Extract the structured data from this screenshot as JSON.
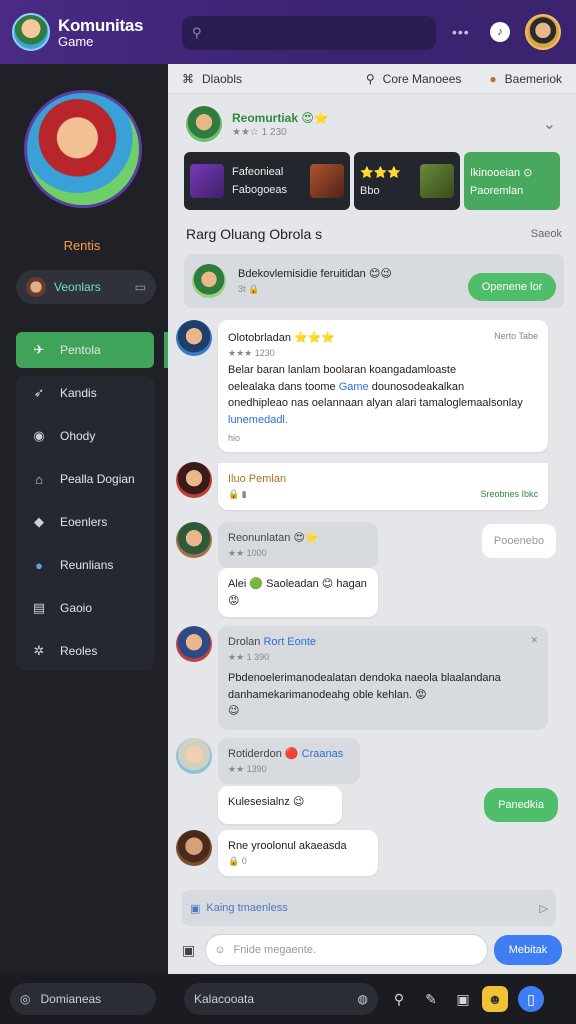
{
  "app": {
    "title": "Komunitas",
    "subtitle": "Game"
  },
  "topbar": {
    "search_placeholder": "",
    "dots": "•••",
    "bell_label": ""
  },
  "sidebar": {
    "hero_name": "Rentis",
    "profile_label": "Veonlars",
    "nav": [
      {
        "icon": "✈",
        "label": "Pentola",
        "active": true
      },
      {
        "icon": "➶",
        "label": "Kandis"
      },
      {
        "icon": "◉",
        "label": "Ohody"
      },
      {
        "icon": "⌂",
        "label": "Pealla Dogian"
      },
      {
        "icon": "◆",
        "label": "Eoenlers"
      },
      {
        "icon": "●",
        "label": "Reunlians"
      },
      {
        "icon": "▤",
        "label": "Gaoio"
      },
      {
        "icon": "✲",
        "label": "Reoles"
      }
    ]
  },
  "main": {
    "tabs": {
      "left_label": "Dlaobls",
      "right1_label": "Core Manoees",
      "right2_label": "Baemeriok"
    },
    "group": {
      "title": "Reomurtiak",
      "emoji": "😍⭐",
      "meta": "★★☆ 1 230"
    },
    "tiles": [
      {
        "line1": "Fafeonieal",
        "line2": "Fabogoeas"
      },
      {
        "line1": "⭐⭐⭐",
        "line2": "Bbo"
      },
      {
        "line1": "Ikinooeian ⊙",
        "line2": "Paoremlan"
      }
    ],
    "section": {
      "title": "Rarg Oluang Obrola s",
      "more": "Saeok"
    },
    "notice": {
      "text": "Bdekovlemisidie feruitidan 😊😉",
      "meta": "3t  🔒",
      "button": "Openene lor"
    },
    "messages": [
      {
        "name": "Olotobrladan ⭐⭐⭐",
        "meta": "★★★ 1230",
        "right_meta": "Nerto  Tabe",
        "line1": "Belar baran lanlam boolaran koangadamloaste",
        "line2a": "oelealaka dans toome ",
        "line2_link": "Game",
        "line2b": " dounosodeakalkan",
        "line3": "onedhipleao nas oelannaan alyan alari tamaloglemaalsonlay",
        "line4_link": "lunemedadl.",
        "footer": "hio"
      },
      {
        "name": "Iluo Pemlan",
        "meta": "🔒  ▮",
        "right_meta": "Sreobnes  Ibkc"
      },
      {
        "name": "Reonunlatan 😍⭐",
        "meta": "★★ 1000",
        "pill": "Pooenebo"
      },
      {
        "text": "Alei 🟢 Saoleadan 😊 hagan 😡"
      },
      {
        "name": "Drolan",
        "name_link": "Rort Eonte",
        "meta": "★★ 1 390",
        "line1": "Pbdenoelerimanodealatan dendoka naeola blaalandana",
        "line2": "danhamekarimanodeahg oble kehlan. 😡",
        "line3": "😉"
      },
      {
        "name": "Rotiderdon",
        "name_link": "🔴 Craanas",
        "meta": "★★ 1390"
      },
      {
        "text": "Kulesesialnz 😉",
        "button": "Panedkia"
      },
      {
        "text": "Rne yroolonul akaeasda",
        "meta": "🔒  0"
      }
    ],
    "composer_hint": "Kaing tmaenless",
    "composer_placeholder": "Fnide megaente.",
    "send_label": "Mebitak"
  },
  "bottom": {
    "left_label": "Domianeas",
    "pill_label": "Kalacooata"
  },
  "colors": {
    "brand": "#4a2a85",
    "accent_green": "#3fa35a",
    "blue": "#3f7ef2",
    "yellow": "#f2c236"
  }
}
